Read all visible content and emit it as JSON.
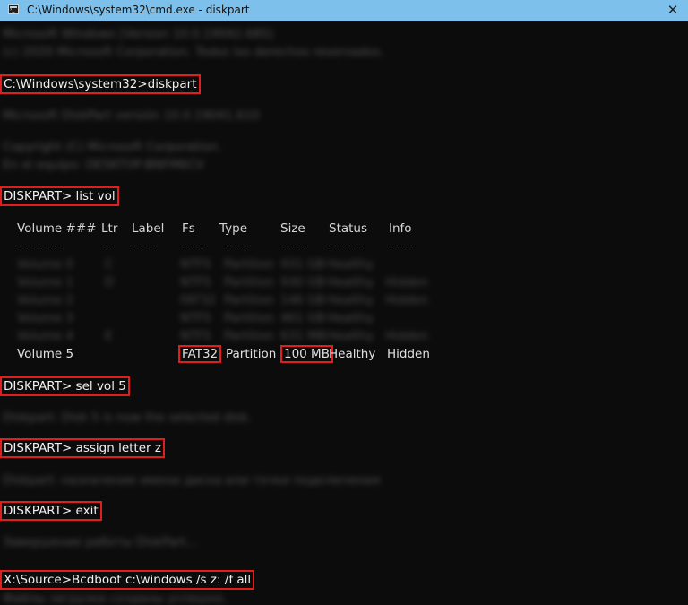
{
  "window": {
    "title": "C:\\Windows\\system32\\cmd.exe - diskpart",
    "close_glyph": "✕"
  },
  "console": {
    "blur_header": [
      "Microsoft Windows [Version 10.0.19042.685]",
      "(c) 2020 Microsoft Corporation. Todos los derechos reservados."
    ],
    "cmd_diskpart": "C:\\Windows\\system32>diskpart",
    "blur_diskpart_version": "Microsoft DiskPart versión 10.0.19041.610",
    "blur_copyright": [
      "Copyright (C) Microsoft Corporation.",
      "En el equipo: DESKTOP-BNFM6CV"
    ],
    "cmd_list_vol": "DISKPART> list vol",
    "table": {
      "headers": [
        "Volume ###",
        "Ltr",
        "Label",
        "Fs",
        "Type",
        "Size",
        "Status",
        "Info"
      ],
      "dashes": [
        "----------",
        "---",
        "-----",
        "-----",
        "-----",
        "------",
        "-------",
        "------"
      ],
      "blurred_rows": [
        [
          "Volume 0",
          "C",
          "",
          "NTFS",
          "Partition",
          "931 GB",
          "Healthy",
          ""
        ],
        [
          "Volume 1",
          "D",
          "",
          "NTFS",
          "Partition",
          "930 GB",
          "Healthy",
          "Hidden"
        ],
        [
          "Volume 2",
          "",
          "",
          "FAT32",
          "Partition",
          "146 GB",
          "Healthy",
          "Hidden"
        ],
        [
          "Volume 3",
          "",
          "",
          "NTFS",
          "Partition",
          "461 GB",
          "Healthy",
          ""
        ],
        [
          "Volume 4",
          "E",
          "",
          "NTFS",
          "Partition",
          "631 MB",
          "Healthy",
          "Hidden"
        ]
      ],
      "highlight_row": {
        "volume": "Volume 5",
        "fs": "FAT32",
        "type": "Partition",
        "size": "100 MB",
        "status": "Healthy",
        "info": "Hidden"
      }
    },
    "cmd_sel_vol": "DISKPART> sel vol 5",
    "blur_selected": "Diskpart: Disk 5 is now the selected disk.",
    "cmd_assign": "DISKPART> assign letter z",
    "blur_assign": "Diskpart: назначение имени диска или точки подключения",
    "cmd_exit": "DISKPART> exit",
    "blur_exit": "Завершение работы DiskPart...",
    "cmd_bcdboot": "X:\\Source>Bcdboot  c:\\windows /s z: /f all",
    "blur_bcdboot": "Файлы загрузки созданы успешно."
  }
}
